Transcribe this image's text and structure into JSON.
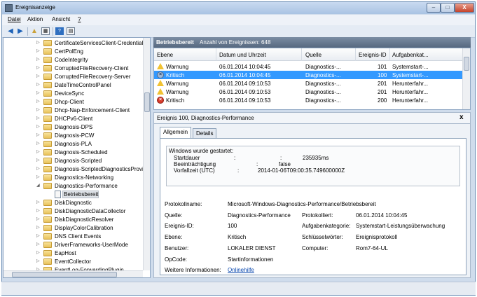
{
  "window": {
    "title": "Ereignisanzeige",
    "controls": {
      "minimize": "–",
      "maximize": "□",
      "close": "X"
    }
  },
  "menu": [
    "Datei",
    "Aktion",
    "Ansicht",
    "?"
  ],
  "tree": {
    "items": [
      "CertificateServicesClient-CredentialR",
      "CertPolEng",
      "CodeIntegrity",
      "CorruptedFileRecovery-Client",
      "CorruptedFileRecovery-Server",
      "DateTimeControlPanel",
      "DeviceSync",
      "Dhcp-Client",
      "Dhcp-Nap-Enforcement-Client",
      "DHCPv6-Client",
      "Diagnosis-DPS",
      "Diagnosis-PCW",
      "Diagnosis-PLA",
      "Diagnosis-Scheduled",
      "Diagnosis-Scripted",
      "Diagnosis-ScriptedDiagnosticsProvic",
      "Diagnostics-Networking",
      "Diagnostics-Performance",
      "Betriebsbereit",
      "DiskDiagnostic",
      "DiskDiagnosticDataCollector",
      "DiskDiagnosticResolver",
      "DisplayColorCalibration",
      "DNS Client Events",
      "DriverFrameworks-UserMode",
      "EapHost",
      "EventCollector",
      "EventLog-ForwardingPlugin"
    ]
  },
  "log_header": {
    "name": "Betriebsbereit",
    "count": "Anzahl von Ereignissen: 648"
  },
  "grid": {
    "columns": [
      "Ebene",
      "Datum und Uhrzeit",
      "Quelle",
      "Ereignis-ID",
      "Aufgabenkat..."
    ],
    "rows": [
      [
        "Warnung",
        "06.01.2014 10:04:45",
        "Diagnostics-...",
        "101",
        "Systemstart-..."
      ],
      [
        "Kritisch",
        "06.01.2014 10:04:45",
        "Diagnostics-...",
        "100",
        "Systemstart-..."
      ],
      [
        "Warnung",
        "06.01.2014 09:10:53",
        "Diagnostics-...",
        "201",
        "Herunterfahr..."
      ],
      [
        "Warnung",
        "06.01.2014 09:10:53",
        "Diagnostics-...",
        "201",
        "Herunterfahr..."
      ],
      [
        "Kritisch",
        "06.01.2014 09:10:53",
        "Diagnostics-...",
        "200",
        "Herunterfahr..."
      ]
    ]
  },
  "detail": {
    "title": "Ereignis 100, Diagnostics-Performance",
    "close": "x",
    "tabs": [
      "Allgemein",
      "Details"
    ],
    "message": {
      "line1": "Windows wurde gestartet:",
      "r1l": "Startdauer",
      "r1c": ":",
      "r1s": ":",
      "r1v": "235935ms",
      "r2l": "Beeinträchtigung",
      "r2s": ":",
      "r2v": "false",
      "r3l": "Vorfallzeit (UTC)",
      "r3s": ":",
      "r3v": "2014-01-06T09:00:35.749600000Z"
    },
    "fields": {
      "protokollname_label": "Protokollname:",
      "protokollname": "Microsoft-Windows-Diagnostics-Performance/Betriebsbereit",
      "quelle_label": "Quelle:",
      "quelle": "Diagnostics-Performance",
      "protokolliert_label": "Protokolliert:",
      "protokolliert": "06.01.2014 10:04:45",
      "id_label": "Ereignis-ID:",
      "id": "100",
      "kategorie_label": "Aufgabenkategorie:",
      "kategorie": "Systemstart-Leistungsüberwachung",
      "ebene_label": "Ebene:",
      "ebene": "Kritisch",
      "schluessel_label": "Schlüsselwörter:",
      "schluessel": "Ereignisprotokoll",
      "benutzer_label": "Benutzer:",
      "benutzer": "LOKALER DIENST",
      "computer_label": "Computer:",
      "computer": "Rom7-64-UL",
      "opcode_label": "OpCode:",
      "opcode": "Startinformationen",
      "info_label": "Weitere Informationen:",
      "info_link": "Onlinehilfe"
    }
  }
}
